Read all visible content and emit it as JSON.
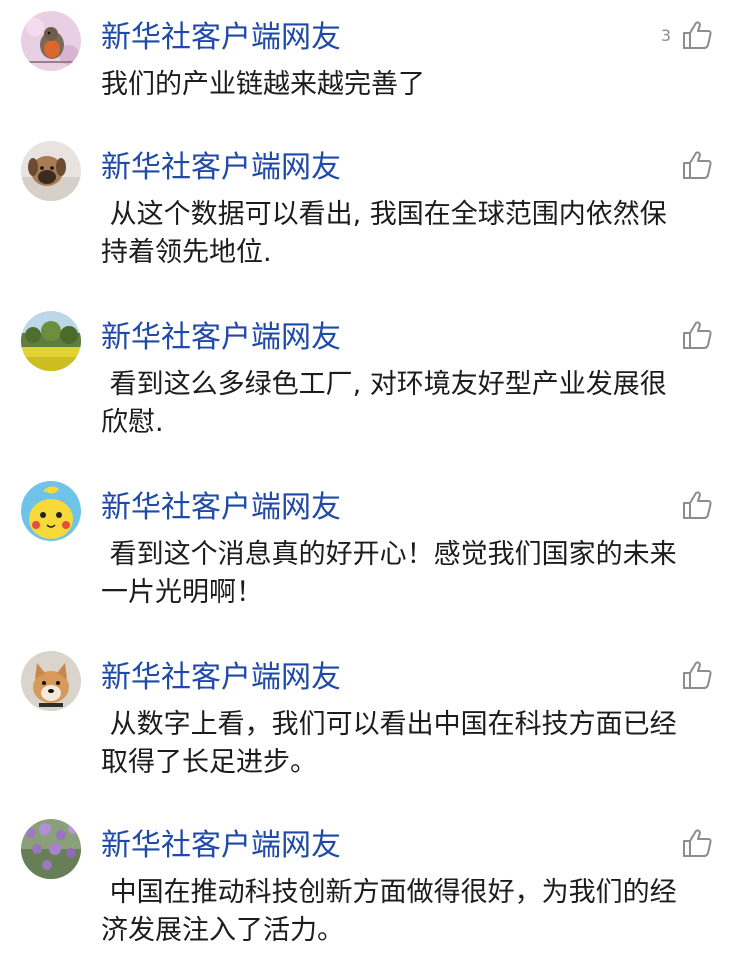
{
  "comments": [
    {
      "username": "新华社客户端网友",
      "text": "我们的产业链越来越完善了",
      "like_count": "3"
    },
    {
      "username": "新华社客户端网友",
      "text": " 从这个数据可以看出, 我国在全球范围内依然保持着领先地位.",
      "like_count": ""
    },
    {
      "username": "新华社客户端网友",
      "text": " 看到这么多绿色工厂, 对环境友好型产业发展很欣慰.",
      "like_count": ""
    },
    {
      "username": "新华社客户端网友",
      "text": " 看到这个消息真的好开心！感觉我们国家的未来一片光明啊！",
      "like_count": ""
    },
    {
      "username": "新华社客户端网友",
      "text": " 从数字上看，我们可以看出中国在科技方面已经取得了长足进步。",
      "like_count": ""
    },
    {
      "username": "新华社客户端网友",
      "text": " 中国在推动科技创新方面做得很好，为我们的经济发展注入了活力。",
      "like_count": ""
    }
  ],
  "colors": {
    "username": "#1f4aa8",
    "text": "#1c1c1c",
    "like": "#8c8c8c"
  },
  "icons": {
    "like": "thumbs-up-outline-icon"
  }
}
